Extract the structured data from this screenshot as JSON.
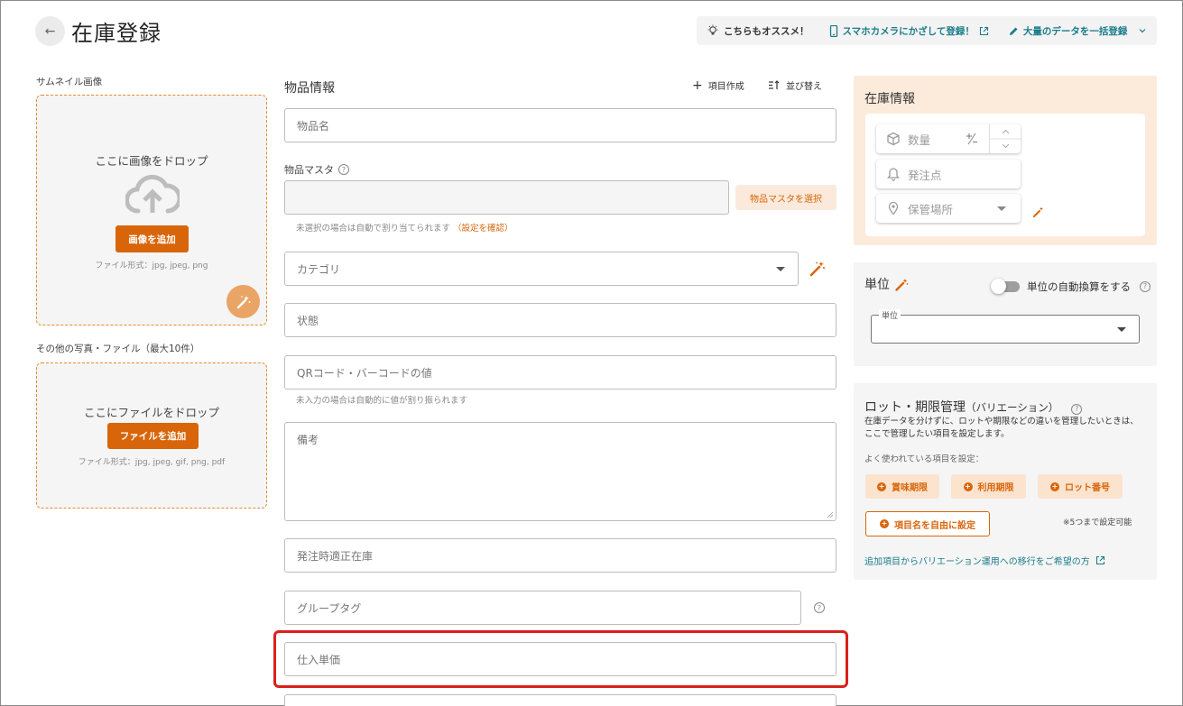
{
  "header": {
    "title": "在庫登録",
    "promo_label": "こちらもオススメ！",
    "promo_link_camera": "スマホカメラにかざして登録！",
    "promo_link_bulk": "大量のデータを一括登録"
  },
  "left": {
    "thumbnail_label": "サムネイル画像",
    "thumbnail_drop_text": "ここに画像をドロップ",
    "thumbnail_add_button": "画像を追加",
    "thumbnail_formats": "ファイル形式：jpg, jpeg, png",
    "files_label": "その他の写真・ファイル（最大10件）",
    "files_drop_text": "ここにファイルをドロップ",
    "files_add_button": "ファイルを追加",
    "files_formats": "ファイル形式：jpg, jpeg, gif, png, pdf"
  },
  "middle": {
    "section_title": "物品情報",
    "create_item_button": "項目作成",
    "sort_button": "並び替え",
    "item_name_placeholder": "物品名",
    "master_label": "物品マスタ",
    "master_select_button": "物品マスタを選択",
    "master_hint": "未選択の場合は自動で割り当てられます",
    "master_hint_link": "（設定を確認）",
    "category_placeholder": "カテゴリ",
    "status_placeholder": "状態",
    "code_placeholder": "QRコード・バーコードの値",
    "code_hint": "未入力の場合は自動的に値が割り振られます",
    "notes_placeholder": "備考",
    "reorder_stock_placeholder": "発注時適正在庫",
    "group_tag_placeholder": "グループタグ",
    "purchase_price_placeholder": "仕入単価"
  },
  "right": {
    "stock_title": "在庫情報",
    "quantity_placeholder": "数量",
    "reorder_point_placeholder": "発注点",
    "location_placeholder": "保管場所",
    "unit_title": "単位",
    "auto_convert_label": "単位の自動換算をする",
    "unit_select_legend": "単位",
    "lot_title": "ロット・期限管理",
    "lot_subtitle": "（バリエーション）",
    "lot_description": "在庫データを分けずに、ロットや期限などの違いを管理したいときは、ここで管理したい項目を設定します。",
    "common_items_label": "よく使われている項目を設定：",
    "chips": [
      "賞味期限",
      "利用期限",
      "ロット番号"
    ],
    "custom_item_button": "項目名を自由に設定",
    "limit_note": "※5つまで設定可能",
    "migration_link": "追加項目からバリエーション運用への移行をご希望の方"
  },
  "colors": {
    "accent_orange": "#d9650a",
    "teal_link": "#1a7c8a",
    "highlight_red": "#d9211b"
  }
}
